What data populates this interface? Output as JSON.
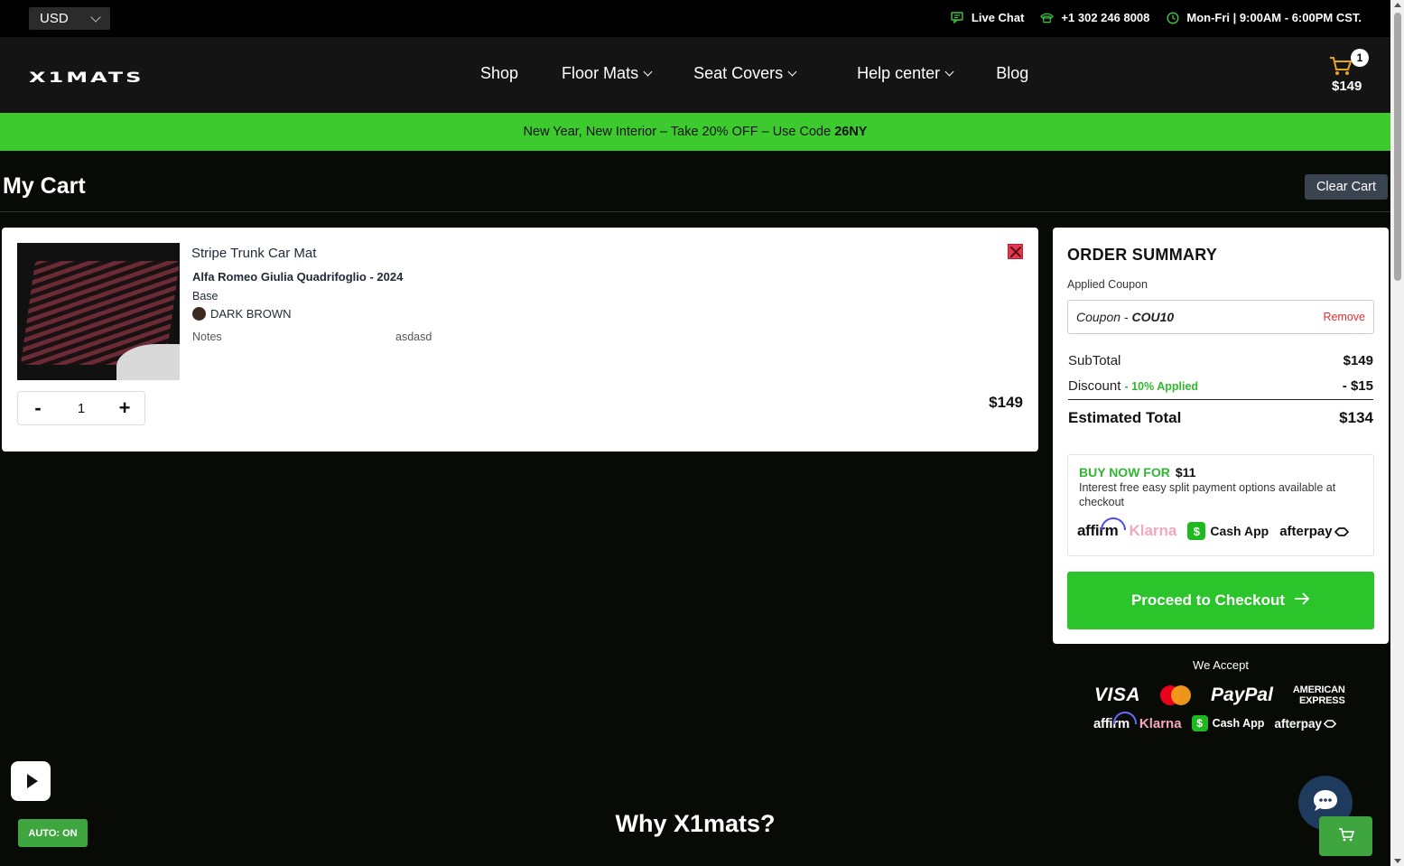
{
  "topbar": {
    "currency": "USD",
    "live_chat": "Live Chat",
    "phone": "+1 302 246 8008",
    "hours": "Mon-Fri | 9:00AM - 6:00PM CST."
  },
  "header": {
    "logo": "X1MATS",
    "nav": [
      "Shop",
      "Floor Mats",
      "Seat Covers",
      "Help center",
      "Blog"
    ],
    "cart_count": "1",
    "cart_total": "$149"
  },
  "promo": {
    "text": "New Year, New Interior – Take 20% OFF – Use Code",
    "code": "26NY"
  },
  "cart": {
    "title": "My Cart",
    "clear_label": "Clear Cart",
    "item": {
      "name": "Stripe Trunk Car Mat",
      "vehicle": "Alfa Romeo Giulia Quadrifoglio - 2024",
      "trim": "Base",
      "color": "DARK BROWN",
      "color_hex": "#3b2a20",
      "notes_label": "Notes",
      "notes_value": "asdasd",
      "qty_minus": "-",
      "quantity": "1",
      "qty_plus": "+",
      "price": "$149"
    }
  },
  "summary": {
    "title": "ORDER SUMMARY",
    "applied_label": "Applied Coupon",
    "coupon_prefix": "Coupon -",
    "coupon_code": "COU10",
    "remove_label": "Remove",
    "subtotal_label": "SubTotal",
    "subtotal_value": "$149",
    "discount_label": "Discount",
    "discount_note": "- 10% Applied",
    "discount_value": "- $15",
    "total_label": "Estimated Total",
    "total_value": "$134",
    "bnpl_heading": "BUY NOW FOR",
    "bnpl_amount": "$11",
    "bnpl_desc": "Interest free easy split payment options available at checkout",
    "bnpl_logos": [
      "affirm",
      "Klarna",
      "Cash App",
      "afterpay"
    ],
    "checkout_label": "Proceed to Checkout"
  },
  "accept": {
    "label": "We Accept",
    "row1": [
      "VISA",
      "PayPal",
      "AMERICAN",
      "EXPRESS"
    ],
    "row2": [
      "affirm",
      "Klarna",
      "Cash App",
      "afterpay"
    ]
  },
  "bottom": {
    "auto_label": "AUTO: ON",
    "why_title": "Why X1mats?"
  },
  "colors": {
    "accent_green": "#3cca2e",
    "danger_red": "#e23b4f",
    "background": "#070a05"
  }
}
